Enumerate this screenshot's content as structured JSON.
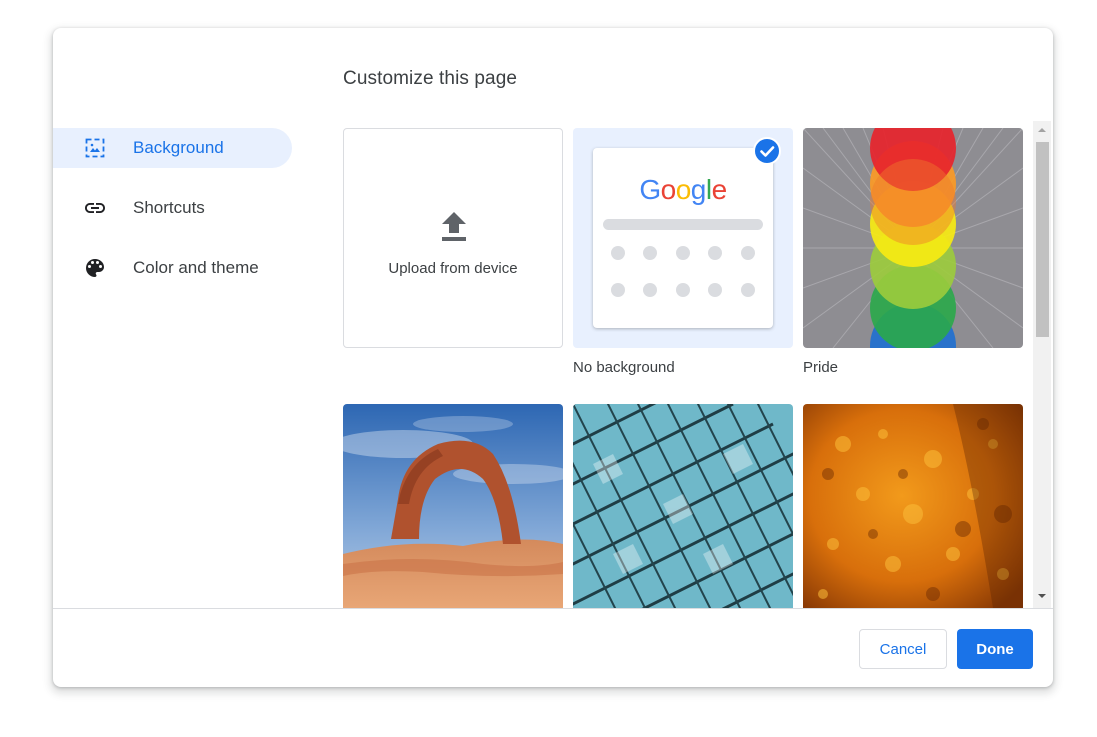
{
  "dialog": {
    "title": "Customize this page"
  },
  "sidebar": {
    "items": [
      {
        "label": "Background",
        "icon": "background-image-icon",
        "selected": true
      },
      {
        "label": "Shortcuts",
        "icon": "link-icon",
        "selected": false
      },
      {
        "label": "Color and theme",
        "icon": "palette-icon",
        "selected": false
      }
    ]
  },
  "backgrounds": {
    "upload": {
      "label": "Upload from device",
      "icon": "upload-icon"
    },
    "no_background": {
      "label": "No background",
      "selected": true,
      "logo_text": "Google"
    },
    "pride": {
      "label": "Pride"
    },
    "thumbnails": [
      "rock-arch-thumbnail",
      "glass-building-thumbnail",
      "orange-texture-thumbnail"
    ]
  },
  "footer": {
    "cancel_label": "Cancel",
    "done_label": "Done"
  },
  "colors": {
    "accent": "#1a73e8",
    "selected_nav_bg": "#e8f0fe",
    "text": "#3c4043",
    "border": "#dadce0"
  }
}
